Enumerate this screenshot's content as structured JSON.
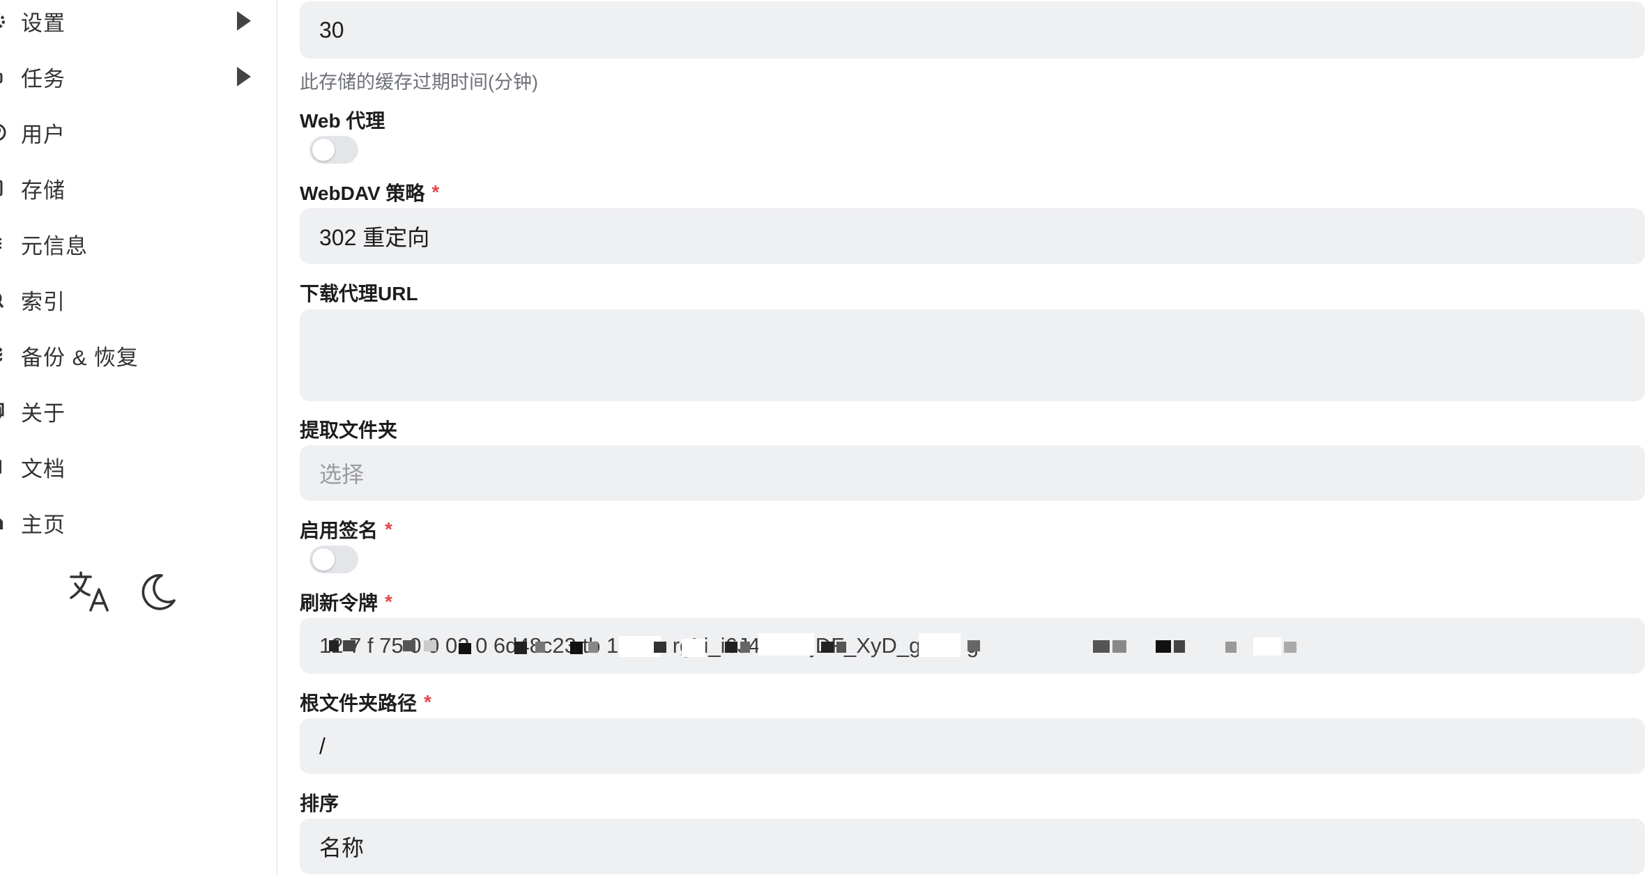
{
  "sidebar": {
    "items": [
      {
        "label": "设置",
        "icon": "gear-icon",
        "has_arrow": true
      },
      {
        "label": "任务",
        "icon": "task-icon",
        "has_arrow": true
      },
      {
        "label": "用户",
        "icon": "user-icon",
        "has_arrow": false
      },
      {
        "label": "存储",
        "icon": "storage-icon",
        "has_arrow": false
      },
      {
        "label": "元信息",
        "icon": "meta-icon",
        "has_arrow": false
      },
      {
        "label": "索引",
        "icon": "search-icon",
        "has_arrow": false
      },
      {
        "label": "备份 & 恢复",
        "icon": "database-icon",
        "has_arrow": false
      },
      {
        "label": "关于",
        "icon": "copy-icon",
        "has_arrow": false
      },
      {
        "label": "文档",
        "icon": "book-icon",
        "has_arrow": false
      },
      {
        "label": "主页",
        "icon": "home-icon",
        "has_arrow": false
      }
    ],
    "bottom": {
      "language_icon": "translate-icon",
      "theme_icon": "moon-icon"
    }
  },
  "form": {
    "cache_expiration": {
      "value": "30",
      "help": "此存储的缓存过期时间(分钟)"
    },
    "web_proxy": {
      "label": "Web 代理",
      "enabled": false
    },
    "webdav_policy": {
      "label": "WebDAV 策略",
      "required": "*",
      "value": "302 重定向"
    },
    "download_proxy_url": {
      "label": "下载代理URL",
      "value": ""
    },
    "extract_folder": {
      "label": "提取文件夹",
      "placeholder": "选择"
    },
    "enable_sign": {
      "label": "启用签名",
      "required": "*",
      "enabled": false
    },
    "refresh_token": {
      "label": "刷新令牌",
      "required": "*",
      "value": "12      7  f  75 0  0  02 0 6d48c23    tb 1 X      Kr rgLi_i6J4mHOjDF_XyD_gQ      i8 g"
    },
    "root_folder_path": {
      "label": "根文件夹路径",
      "required": "*",
      "value": "/"
    },
    "order_by": {
      "label": "排序",
      "value": "名称"
    }
  }
}
